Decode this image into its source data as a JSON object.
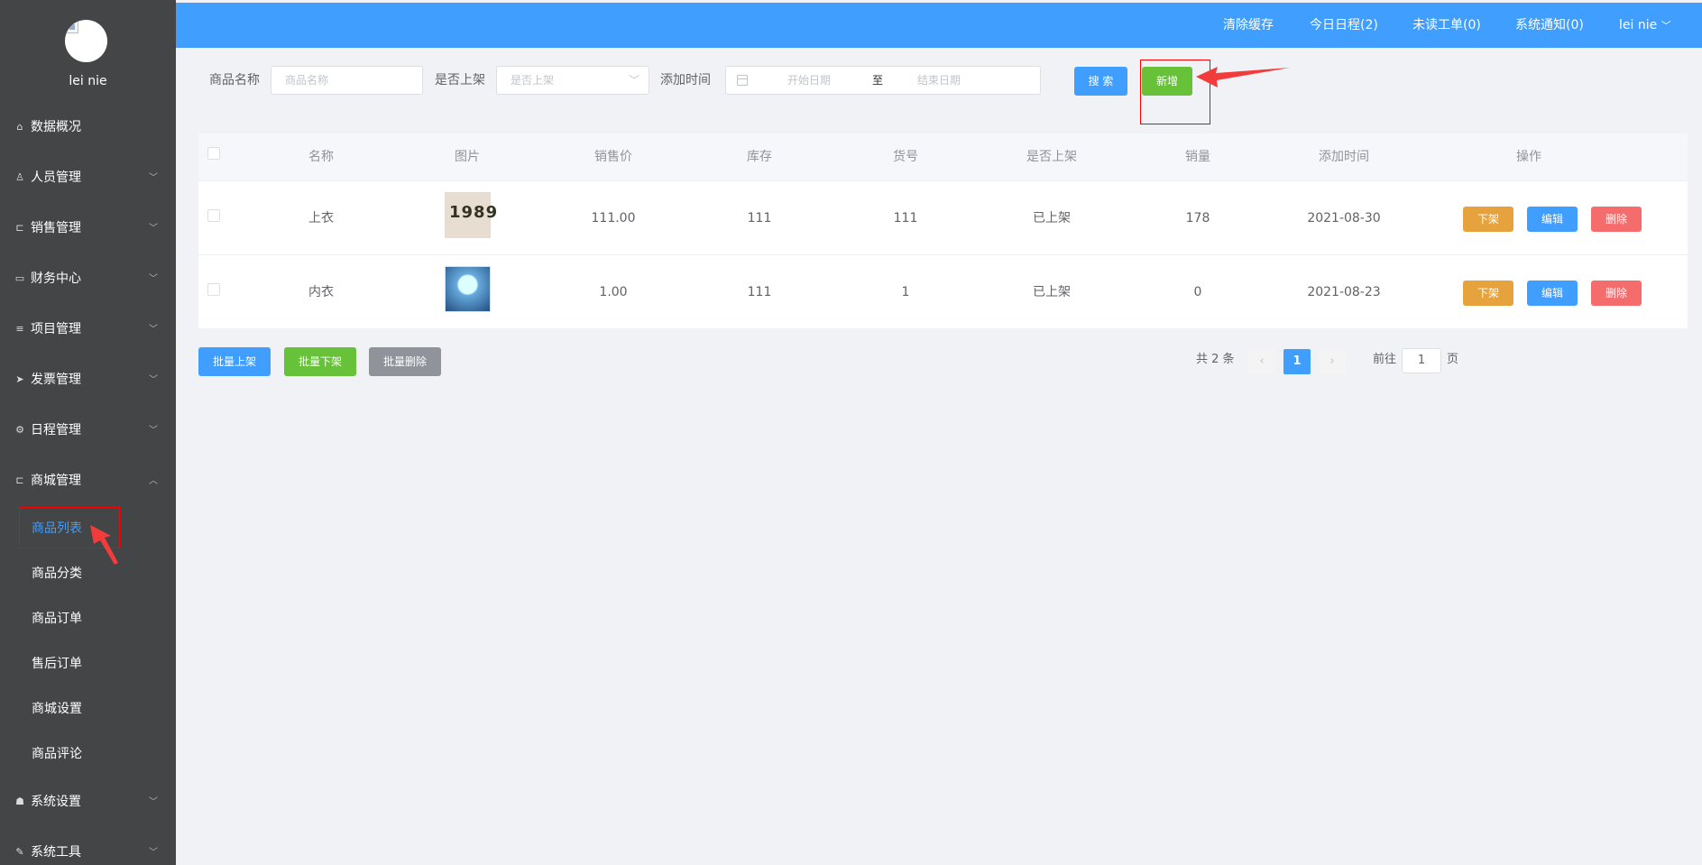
{
  "sidebar": {
    "username": "lei nie",
    "menu": [
      {
        "label": "数据概况",
        "icon": "home-icon",
        "glyph": "⌂"
      },
      {
        "label": "人员管理",
        "icon": "user-icon",
        "glyph": "♙"
      },
      {
        "label": "销售管理",
        "icon": "cart-icon",
        "glyph": "⊏"
      },
      {
        "label": "财务中心",
        "icon": "money-icon",
        "glyph": "▭"
      },
      {
        "label": "项目管理",
        "icon": "database-icon",
        "glyph": "≡"
      },
      {
        "label": "发票管理",
        "icon": "send-icon",
        "glyph": "➤"
      },
      {
        "label": "日程管理",
        "icon": "gear-icon",
        "glyph": "⚙"
      },
      {
        "label": "商城管理",
        "icon": "cart-icon",
        "glyph": "⊏"
      },
      {
        "label": "系统设置",
        "icon": "users-icon",
        "glyph": "☗"
      },
      {
        "label": "系统工具",
        "icon": "wrench-icon",
        "glyph": "✎"
      }
    ],
    "submenu": [
      "商品列表",
      "商品分类",
      "商品订单",
      "售后订单",
      "商城设置",
      "商品评论"
    ]
  },
  "header": {
    "clear_cache": "清除缓存",
    "today_schedule": "今日日程(2)",
    "unread_orders": "未读工单(0)",
    "system_notice": "系统通知(0)",
    "user": "lei nie"
  },
  "search": {
    "name_label": "商品名称",
    "name_placeholder": "商品名称",
    "shelf_label": "是否上架",
    "shelf_placeholder": "是否上架",
    "time_label": "添加时间",
    "start_placeholder": "开始日期",
    "range_sep": "至",
    "end_placeholder": "结束日期",
    "search_button": "搜 索",
    "add_button": "新增"
  },
  "table": {
    "headers": [
      "名称",
      "图片",
      "销售价",
      "库存",
      "货号",
      "是否上架",
      "销量",
      "添加时间",
      "操作"
    ],
    "rows": [
      {
        "name": "上衣",
        "image_text": "1989",
        "price": "111.00",
        "stock": "111",
        "sku": "111",
        "status": "已上架",
        "sales": "178",
        "date": "2021-08-30"
      },
      {
        "name": "内衣",
        "image_text": "",
        "price": "1.00",
        "stock": "111",
        "sku": "1",
        "status": "已上架",
        "sales": "0",
        "date": "2021-08-23"
      }
    ],
    "actions": {
      "off_shelf": "下架",
      "edit": "编辑",
      "delete": "删除"
    }
  },
  "bulk": {
    "on_shelf": "批量上架",
    "off_shelf": "批量下架",
    "delete": "批量删除"
  },
  "pagination": {
    "total": "共 2 条",
    "prev": "‹",
    "current": "1",
    "next": "›",
    "goto": "前往",
    "page_value": "1",
    "page_suffix": "页"
  }
}
